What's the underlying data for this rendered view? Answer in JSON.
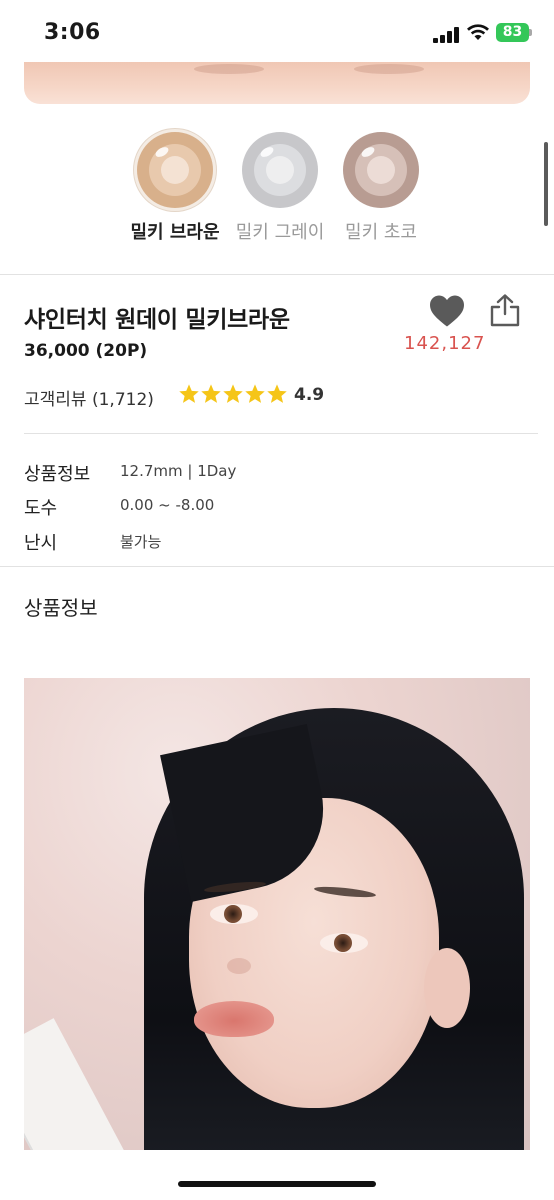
{
  "status_bar": {
    "time": "3:06",
    "battery": "83",
    "battery_color": "#34c759"
  },
  "color_options": [
    {
      "label": "밀키 브라운",
      "selected": true,
      "ring": "#d8b08b",
      "inner": "#e8c9ad",
      "pupil": "#f4e2d3"
    },
    {
      "label": "밀키 그레이",
      "selected": false,
      "ring": "#c7c7ca",
      "inner": "#dcdde0",
      "pupil": "#eeeeef"
    },
    {
      "label": "밀키 초코",
      "selected": false,
      "ring": "#b89c92",
      "inner": "#d6c0b8",
      "pupil": "#ecdcd6"
    }
  ],
  "product": {
    "title": "샤인터치 원데이 밀키브라운",
    "price": "36,000 (20P)",
    "like_count": "142,127",
    "review_label": "고객리뷰 (1,712)",
    "rating": "4.9",
    "stars": 5,
    "star_color": "#f5c518",
    "like_color": "#d9534f"
  },
  "info": [
    {
      "label": "상품정보",
      "value": "12.7mm | 1Day"
    },
    {
      "label": "도수",
      "value": "0.00 ~ -8.00"
    },
    {
      "label": "난시",
      "value": "불가능"
    }
  ],
  "section": {
    "title": "상품정보"
  },
  "icons": {
    "like": "heart-icon",
    "share": "share-icon",
    "star": "star-icon"
  }
}
